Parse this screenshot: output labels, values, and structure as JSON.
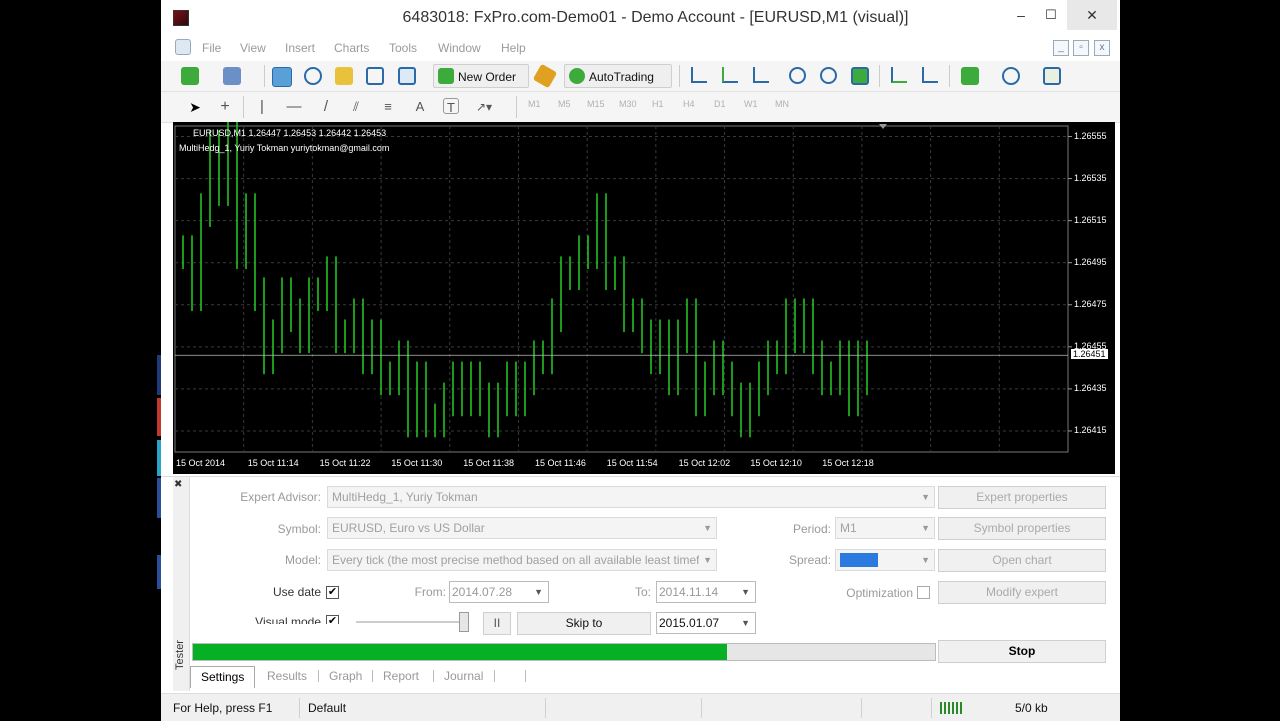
{
  "window": {
    "title": "6483018: FxPro.com-Demo01 - Demo Account - [EURUSD,M1 (visual)]",
    "minimize": "–",
    "maximize": "☐",
    "close": "✕"
  },
  "menu": [
    "File",
    "View",
    "Insert",
    "Charts",
    "Tools",
    "Window",
    "Help"
  ],
  "mdi_controls": [
    "_",
    "▫",
    "x"
  ],
  "toolbar": {
    "new_order": "New Order",
    "autotrading": "AutoTrading"
  },
  "timeframes": [
    "M1",
    "M5",
    "M15",
    "M30",
    "H1",
    "H4",
    "D1",
    "W1",
    "MN"
  ],
  "chart": {
    "legend_line1": "EURUSD,M1  1.26447 1.26453 1.26442 1.26453",
    "legend_line2": "MultiHedg_1, Yuriy Tokman  yuriytokman@gmail.com",
    "current_price": "1.26451",
    "price_labels": [
      "1.26555",
      "1.26535",
      "1.26515",
      "1.26495",
      "1.26475",
      "1.26455",
      "1.26435",
      "1.26415"
    ],
    "time_labels": [
      "15 Oct 2014",
      "15 Oct 11:14",
      "15 Oct 11:22",
      "15 Oct 11:30",
      "15 Oct 11:38",
      "15 Oct 11:46",
      "15 Oct 11:54",
      "15 Oct 12:02",
      "15 Oct 12:10",
      "15 Oct 12:18"
    ],
    "colors": {
      "background": "#000000",
      "bars": "#22c022",
      "grid": "#3a3a3a"
    }
  },
  "chart_data": {
    "type": "bar",
    "symbol": "EURUSD",
    "timeframe": "M1",
    "ylim": [
      1.26405,
      1.2656
    ],
    "close_approx": [
      1.265,
      1.2648,
      1.2652,
      1.2655,
      1.2653,
      1.2656,
      1.265,
      1.2652,
      1.2648,
      1.2645,
      1.2646,
      1.2648,
      1.2647,
      1.2646,
      1.2648,
      1.2648,
      1.2649,
      1.2646,
      1.2646,
      1.2647,
      1.2645,
      1.2646,
      1.2644,
      1.2644,
      1.2645,
      1.2642,
      1.2644,
      1.2642,
      1.2642,
      1.2643,
      1.2644,
      1.2643,
      1.2644,
      1.2643,
      1.2642,
      1.2643,
      1.2644,
      1.2643,
      1.2644,
      1.2645,
      1.2645,
      1.2647,
      1.2649,
      1.2649,
      1.265,
      1.265,
      1.2652,
      1.2649,
      1.2649,
      1.2647,
      1.2647,
      1.2646,
      1.2645,
      1.2646,
      1.2644,
      1.2646,
      1.2647,
      1.2643,
      1.2644,
      1.2645,
      1.2644,
      1.2643,
      1.2642,
      1.2643,
      1.2644,
      1.2645,
      1.2645,
      1.2647,
      1.2646,
      1.2647,
      1.2645,
      1.2644,
      1.2644,
      1.2645,
      1.2643,
      1.2645,
      1.2644
    ]
  },
  "tester": {
    "label": "Tester",
    "expert_advisor_label": "Expert Advisor:",
    "expert_advisor_value": "MultiHedg_1, Yuriy Tokman",
    "symbol_label": "Symbol:",
    "symbol_value": "EURUSD, Euro vs US Dollar",
    "model_label": "Model:",
    "model_value": "Every tick (the most precise method based on all available least timefr",
    "use_date_label": "Use date",
    "from_label": "From:",
    "from_value": "2014.07.28",
    "to_label": "To:",
    "to_value": "2014.11.14",
    "visual_mode_label": "Visual mode",
    "pause_label": "II",
    "skip_to_label": "Skip to",
    "skip_to_value": "2015.01.07",
    "period_label": "Period:",
    "period_value": "M1",
    "spread_label": "Spread:",
    "optimization_label": "Optimization",
    "expert_properties": "Expert properties",
    "symbol_properties": "Symbol properties",
    "open_chart": "Open chart",
    "modify_expert": "Modify expert",
    "stop": "Stop",
    "progress": 0.72,
    "tabs": [
      "Settings",
      "Results",
      "Graph",
      "Report",
      "Journal"
    ]
  },
  "status": {
    "help": "For Help, press F1",
    "profile": "Default",
    "traffic": "5/0 kb"
  }
}
